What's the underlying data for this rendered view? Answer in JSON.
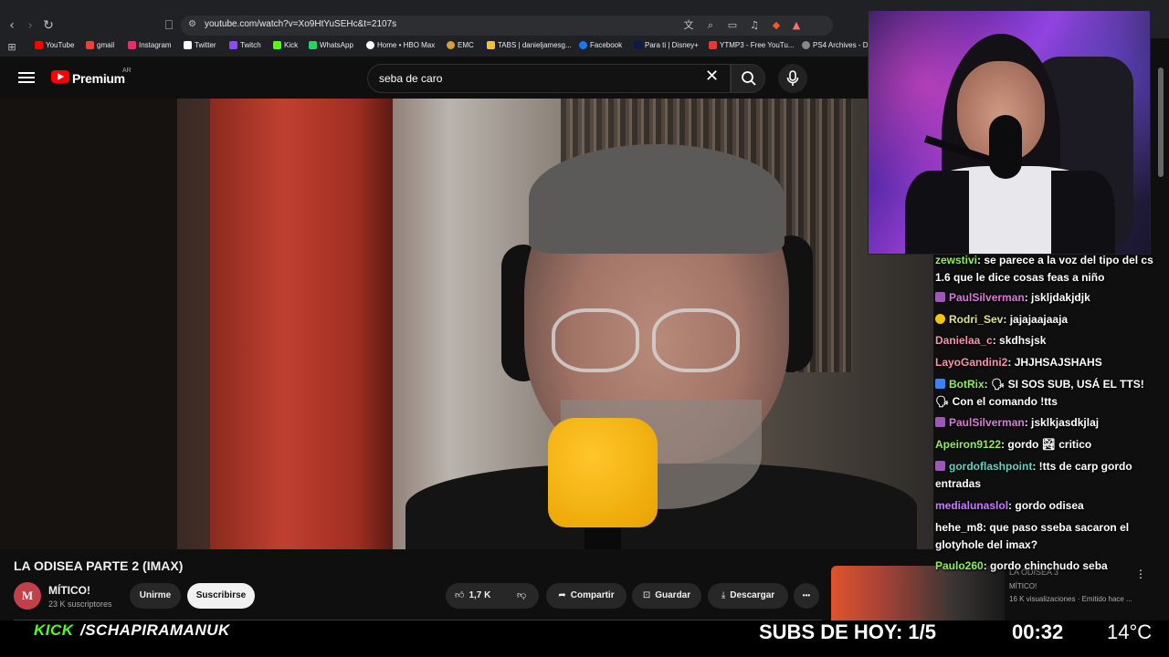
{
  "browser": {
    "url": "youtube.com/watch?v=Xo9HtYuSEHc&t=2107s",
    "bookmarks": [
      {
        "label": "YouTube",
        "color": "#ff0000"
      },
      {
        "label": "gmail",
        "color": "#ea4335"
      },
      {
        "label": "Instagram",
        "color": "#e1306c"
      },
      {
        "label": "Twitter",
        "color": "#ffffff"
      },
      {
        "label": "Twitch",
        "color": "#9146ff"
      },
      {
        "label": "Kick",
        "color": "#53fc18"
      },
      {
        "label": "WhatsApp",
        "color": "#25d366"
      },
      {
        "label": "Home • HBO Max",
        "color": "#ffffff"
      },
      {
        "label": "EMC",
        "color": "#d4a03a"
      },
      {
        "label": "TABS | danieljamesg...",
        "color": "#f1c232"
      },
      {
        "label": "Facebook",
        "color": "#1877f2"
      },
      {
        "label": "Para ti | Disney+",
        "color": "#0d1a4d"
      },
      {
        "label": "YTMP3 - Free YouTu...",
        "color": "#e53935"
      },
      {
        "label": "PS4 Archives - D",
        "color": "#888888"
      }
    ]
  },
  "youtube": {
    "logo_text": "Premium",
    "region": "AR",
    "search_query": "seba de caro"
  },
  "video": {
    "title": "LA ODISEA PARTE 2 (IMAX)",
    "channel": "MÍTICO!",
    "channel_initial": "M",
    "subscribers": "23 K suscriptores",
    "join_label": "Unirme",
    "subscribe_label": "Suscribirse",
    "likes": "1,7 K",
    "share_label": "Compartir",
    "save_label": "Guardar",
    "download_label": "Descargar",
    "more_label": "•••"
  },
  "recommendation": {
    "title": "LA ODISEA 3",
    "channel": "MÍTICO!",
    "meta": "16 K visualizaciones · Emitido hace ..."
  },
  "chat": [
    {
      "user": "zewstivi",
      "color": "#8cf05a",
      "badge": "",
      "text": ": se parece a la voz del tipo del cs 1.6 que le dice cosas feas a niño"
    },
    {
      "user": "PaulSilverman",
      "color": "#d77bd7",
      "badge": "#9b59b6",
      "text": ": jskljdakjdjk"
    },
    {
      "user": "Rodri_Sev",
      "color": "#e0e38a",
      "badge": "#f1c40f",
      "text": ": jajajaajaaja"
    },
    {
      "user": "Danielaa_c",
      "color": "#ff8fb0",
      "badge": "",
      "text": ": skdhsjsk"
    },
    {
      "user": "LayoGandini2",
      "color": "#ff8fb0",
      "badge": "",
      "text": ": JHJHSAJSHAHS"
    },
    {
      "user": "BotRix",
      "color": "#8cf05a",
      "badge": "#3b82f6",
      "text": ": 🗣 SI SOS SUB, USÁ EL TTS! 🗣 Con el comando !tts"
    },
    {
      "user": "PaulSilverman",
      "color": "#d77bd7",
      "badge": "#9b59b6",
      "text": ": jsklkjasdkjlaj"
    },
    {
      "user": "Apeiron9122",
      "color": "#8cf05a",
      "badge": "",
      "text": ": gordo 🏞 critico"
    },
    {
      "user": "gordoflashpoint",
      "color": "#5ad6c4",
      "badge": "#9b59b6",
      "text": ": !tts de carp gordo entradas"
    },
    {
      "user": "medialunaslol",
      "color": "#c77dff",
      "badge": "",
      "text": ": gordo odisea"
    },
    {
      "user": "hehe_m8",
      "color": "#ffffff",
      "badge": "",
      "text": ": que paso sseba sacaron el glotyhole del imax?"
    },
    {
      "user": "Paulo260",
      "color": "#8cf05a",
      "badge": "",
      "text": ": gordo chinchudo seba"
    }
  ],
  "stream_bar": {
    "brand": "KICK",
    "handle": "/SCHAPIRAMANUK",
    "subs_today": "SUBS DE HOY: 1/5",
    "clock": "00:32",
    "temperature": "14°C"
  },
  "icons": {
    "back": "arrow-left-icon",
    "forward": "arrow-right-icon",
    "reload": "reload-icon",
    "bookmark": "bookmark-icon",
    "search": "search-icon",
    "mic": "mic-icon",
    "like": "thumbs-up-icon",
    "dislike": "thumbs-down-icon",
    "share": "share-icon",
    "save": "save-icon",
    "download": "download-icon"
  }
}
